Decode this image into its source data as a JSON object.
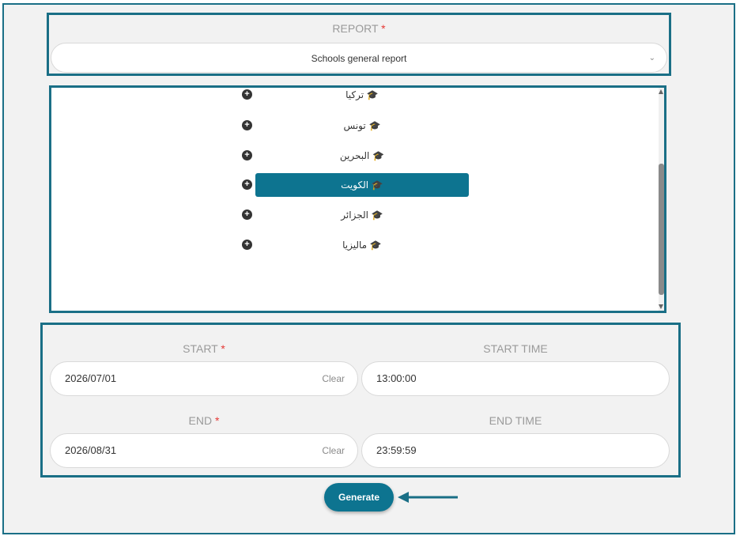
{
  "report": {
    "label": "REPORT",
    "required_mark": "*",
    "selected": "Schools general report"
  },
  "tree": {
    "items": [
      {
        "label": "تركيا",
        "selected": false
      },
      {
        "label": "تونس",
        "selected": false
      },
      {
        "label": "البحرين",
        "selected": false
      },
      {
        "label": "الكويت",
        "selected": true
      },
      {
        "label": "الجزائر",
        "selected": false
      },
      {
        "label": "ماليزيا",
        "selected": false
      }
    ]
  },
  "form": {
    "start_label": "START",
    "start_time_label": "START TIME",
    "end_label": "END",
    "end_time_label": "END TIME",
    "required_mark": "*",
    "start_date": "2026/07/01",
    "start_time": "13:00:00",
    "end_date": "2026/08/31",
    "end_time": "23:59:59",
    "clear_label": "Clear"
  },
  "generate_label": "Generate",
  "colors": {
    "accent": "#0d7490",
    "highlight": "#1a6f86",
    "required": "#e53935"
  }
}
